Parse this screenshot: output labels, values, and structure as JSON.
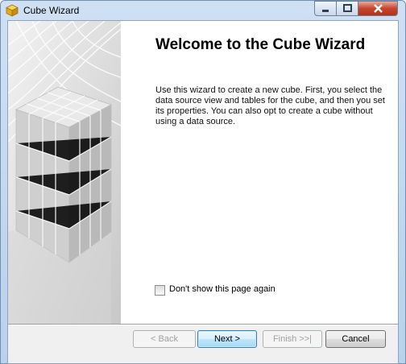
{
  "window": {
    "title": "Cube Wizard",
    "icon": "cube-icon",
    "controls": [
      "minimize-icon",
      "maximize-icon",
      "close-icon"
    ]
  },
  "page": {
    "heading": "Welcome to the Cube Wizard",
    "description": "Use this wizard to create a new cube. First, you select the data source view and tables for the cube, and then you set its properties. You can also opt to create a cube without using a data source."
  },
  "options": {
    "dont_show_label": "Don't show this page again",
    "dont_show_checked": false
  },
  "buttons": {
    "back": "< Back",
    "next": "Next >",
    "finish": "Finish >>|",
    "cancel": "Cancel"
  },
  "colors": {
    "close_button": "#c6452b",
    "default_button_border": "#3c7fb1"
  }
}
